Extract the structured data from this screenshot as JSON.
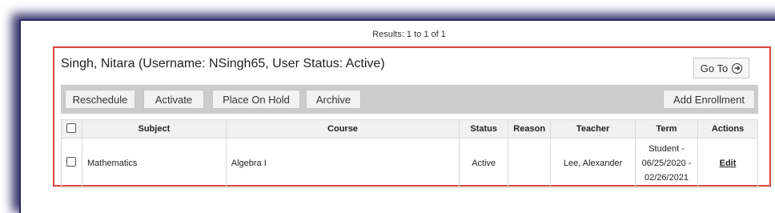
{
  "results_text": "Results: 1 to 1 of 1",
  "student": {
    "title": "Singh, Nitara (Username: NSingh65, User Status: Active)",
    "goto_label": "Go To",
    "goto_icon": "arrow-circle-right-icon"
  },
  "toolbar": {
    "reschedule": "Reschedule",
    "activate": "Activate",
    "place_on_hold": "Place On Hold",
    "archive": "Archive",
    "add_enrollment": "Add Enrollment"
  },
  "table": {
    "headers": [
      "Subject",
      "Course",
      "Status",
      "Reason",
      "Teacher",
      "Term",
      "Actions"
    ],
    "rows": [
      {
        "subject": "Mathematics",
        "course": "Algebra I",
        "status": "Active",
        "reason": "",
        "teacher": "Lee, Alexander",
        "term_line1": "Student -",
        "term_line2": "06/25/2020 -",
        "term_line3": "02/26/2021",
        "action": "Edit"
      }
    ]
  },
  "colors": {
    "highlight_border": "#d9443f",
    "toolbar_bg": "#cccccc",
    "frame_shadow": "#2c2a5e"
  }
}
